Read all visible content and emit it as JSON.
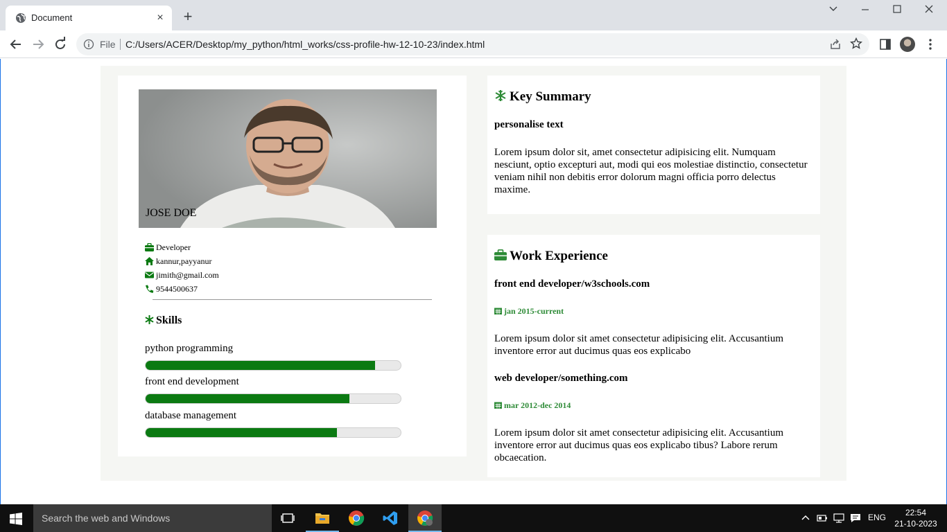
{
  "browser": {
    "tab_title": "Document",
    "tab_close": "×",
    "new_tab": "+",
    "window_controls": {
      "dropdown": "⌄",
      "minimize": "—",
      "maximize": "☐",
      "close": "✕"
    },
    "omnibox": {
      "scheme_label": "File",
      "url": "C:/Users/ACER/Desktop/my_python/html_works/css-profile-hw-12-10-23/index.html"
    }
  },
  "profile": {
    "name": "JOSE DOE",
    "info": [
      {
        "icon": "briefcase-icon",
        "text": "Developer"
      },
      {
        "icon": "home-icon",
        "text": "kannur,payyanur"
      },
      {
        "icon": "envelope-icon",
        "text": "jimith@gmail.com"
      },
      {
        "icon": "phone-icon",
        "text": "9544500637"
      }
    ],
    "skills_title": "Skills",
    "skills": [
      {
        "name": "python programming",
        "level": 0.9
      },
      {
        "name": "front end development",
        "level": 0.8
      },
      {
        "name": "database management",
        "level": 0.75
      }
    ]
  },
  "summary": {
    "title": "Key Summary",
    "subtitle": "personalise text",
    "text": "Lorem ipsum dolor sit, amet consectetur adipisicing elit. Numquam nesciunt, optio excepturi aut, modi qui eos molestiae distinctio, consectetur veniam nihil non debitis error dolorum magni officia porro delectus maxime."
  },
  "work": {
    "title": "Work Experience",
    "jobs": [
      {
        "role": "front end developer/w3schools.com",
        "dates": "jan 2015-current",
        "text": "Lorem ipsum dolor sit amet consectetur adipisicing elit. Accusantium inventore error aut ducimus quas eos explicabo"
      },
      {
        "role": "web developer/something.com",
        "dates": "mar 2012-dec 2014",
        "text": "Lorem ipsum dolor sit amet consectetur adipisicing elit. Accusantium inventore error aut ducimus quas eos explicabo tibus? Labore rerum obcaecation."
      }
    ]
  },
  "colors": {
    "accent": "#0b7a12",
    "date_green": "#2e8b37",
    "page_bg": "#f5f6f3"
  },
  "taskbar": {
    "search_placeholder": "Search the web and Windows",
    "language": "ENG",
    "time": "22:54",
    "date": "21-10-2023"
  }
}
